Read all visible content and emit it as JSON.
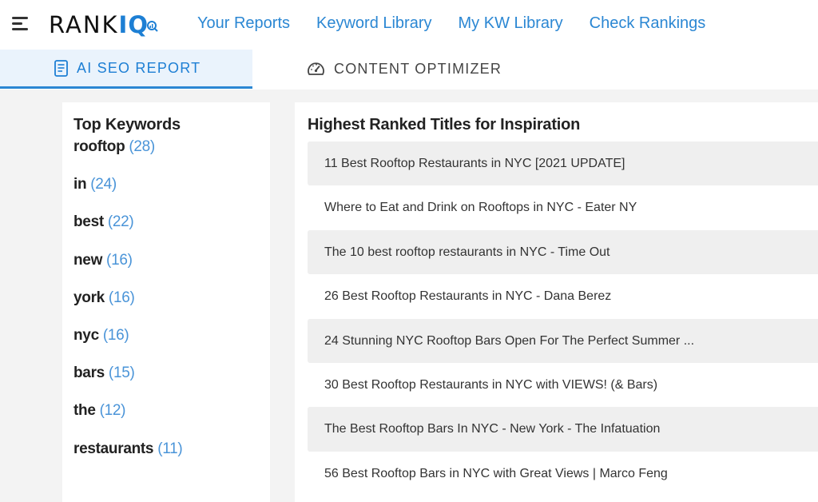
{
  "app": {
    "logo_text": "RANK",
    "logo_accent": "IQ",
    "brand_color": "#1d7fd4",
    "icons": {
      "menu": "hamburger-menu-icon",
      "logo_mark": "chart-magnifier-icon",
      "report": "document-icon",
      "optimizer": "speedometer-icon"
    }
  },
  "nav": {
    "items": [
      {
        "label": "Your Reports"
      },
      {
        "label": "Keyword Library"
      },
      {
        "label": "My KW Library"
      },
      {
        "label": "Check Rankings"
      }
    ]
  },
  "tabs": {
    "ai_seo": "AI SEO REPORT",
    "content_optimizer": "CONTENT OPTIMIZER",
    "active": "AI SEO REPORT"
  },
  "keywords": {
    "title": "Top Keywords",
    "items": [
      {
        "word": "rooftop",
        "count": "(28)"
      },
      {
        "word": "in",
        "count": "(24)"
      },
      {
        "word": "best",
        "count": "(22)"
      },
      {
        "word": "new",
        "count": "(16)"
      },
      {
        "word": "york",
        "count": "(16)"
      },
      {
        "word": "nyc",
        "count": "(16)"
      },
      {
        "word": "bars",
        "count": "(15)"
      },
      {
        "word": "the",
        "count": "(12)"
      },
      {
        "word": "restaurants",
        "count": "(11)"
      }
    ]
  },
  "titles": {
    "heading": "Highest Ranked Titles for Inspiration",
    "items": [
      "11 Best Rooftop Restaurants in NYC [2021 UPDATE]",
      "Where to Eat and Drink on Rooftops in NYC - Eater NY",
      "The 10 best rooftop restaurants in NYC - Time Out",
      "26 Best Rooftop Restaurants in NYC - Dana Berez",
      "24 Stunning NYC Rooftop Bars Open For The Perfect Summer ...",
      "30 Best Rooftop Restaurants in NYC with VIEWS! (& Bars)",
      "The Best Rooftop Bars In NYC - New York - The Infatuation",
      "56 Best Rooftop Bars in NYC with Great Views | Marco Feng"
    ]
  }
}
